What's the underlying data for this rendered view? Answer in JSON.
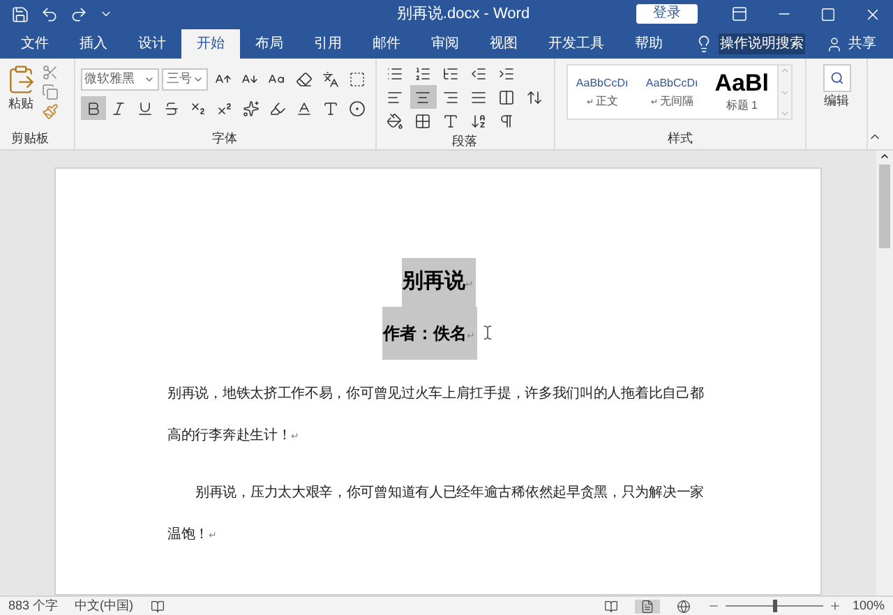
{
  "window": {
    "title": "别再说.docx  -  Word",
    "login": "登录"
  },
  "tabs": [
    {
      "label": "文件",
      "selected": false
    },
    {
      "label": "插入",
      "selected": false
    },
    {
      "label": "设计",
      "selected": false
    },
    {
      "label": "开始",
      "selected": true
    },
    {
      "label": "布局",
      "selected": false
    },
    {
      "label": "引用",
      "selected": false
    },
    {
      "label": "邮件",
      "selected": false
    },
    {
      "label": "审阅",
      "selected": false
    },
    {
      "label": "视图",
      "selected": false
    },
    {
      "label": "开发工具",
      "selected": false
    },
    {
      "label": "帮助",
      "selected": false
    }
  ],
  "tell_me": "操作说明搜索",
  "share": "共享",
  "ribbon": {
    "clipboard": {
      "paste": "粘贴",
      "label": "剪贴板"
    },
    "font": {
      "name": "微软雅黑",
      "size": "三号",
      "bold": true,
      "italic": false,
      "underline": false,
      "label": "字体"
    },
    "paragraph": {
      "align": [
        {
          "kind": "left",
          "selected": false
        },
        {
          "kind": "center",
          "selected": true
        },
        {
          "kind": "right",
          "selected": false
        },
        {
          "kind": "justify",
          "selected": false
        }
      ],
      "label": "段落"
    },
    "styles": {
      "items": [
        {
          "sample": "AaBbCcDı",
          "name": "正文",
          "kind": "normal",
          "mark": "↵"
        },
        {
          "sample": "AaBbCcDı",
          "name": "无间隔",
          "kind": "normal",
          "mark": "↵"
        },
        {
          "sample": "AaBl",
          "name": "标题 1",
          "kind": "heading"
        }
      ],
      "label": "样式"
    },
    "editing": {
      "label": "编辑"
    }
  },
  "document": {
    "title": {
      "text": "别再说",
      "mark": "↵",
      "selected": true
    },
    "author": {
      "text": "作者：佚名",
      "mark": "↵",
      "selected": true
    },
    "paragraphs": [
      {
        "text": "别再说，地铁太挤工作不易，你可曾见过火车上肩扛手提，许多我们叫的人拖着比自己都高的行李奔赴生计！",
        "mark": "↵",
        "indent": false
      },
      {
        "text": "别再说，压力太大艰辛，你可曾知道有人已经年逾古稀依然起早贪黑，只为解决一家温饱！",
        "mark": "↵",
        "indent": true
      }
    ]
  },
  "status_bar": {
    "word_count": "883 个字",
    "language": "中文(中国)",
    "zoom": {
      "level": 0.5,
      "reading": "100%"
    }
  }
}
